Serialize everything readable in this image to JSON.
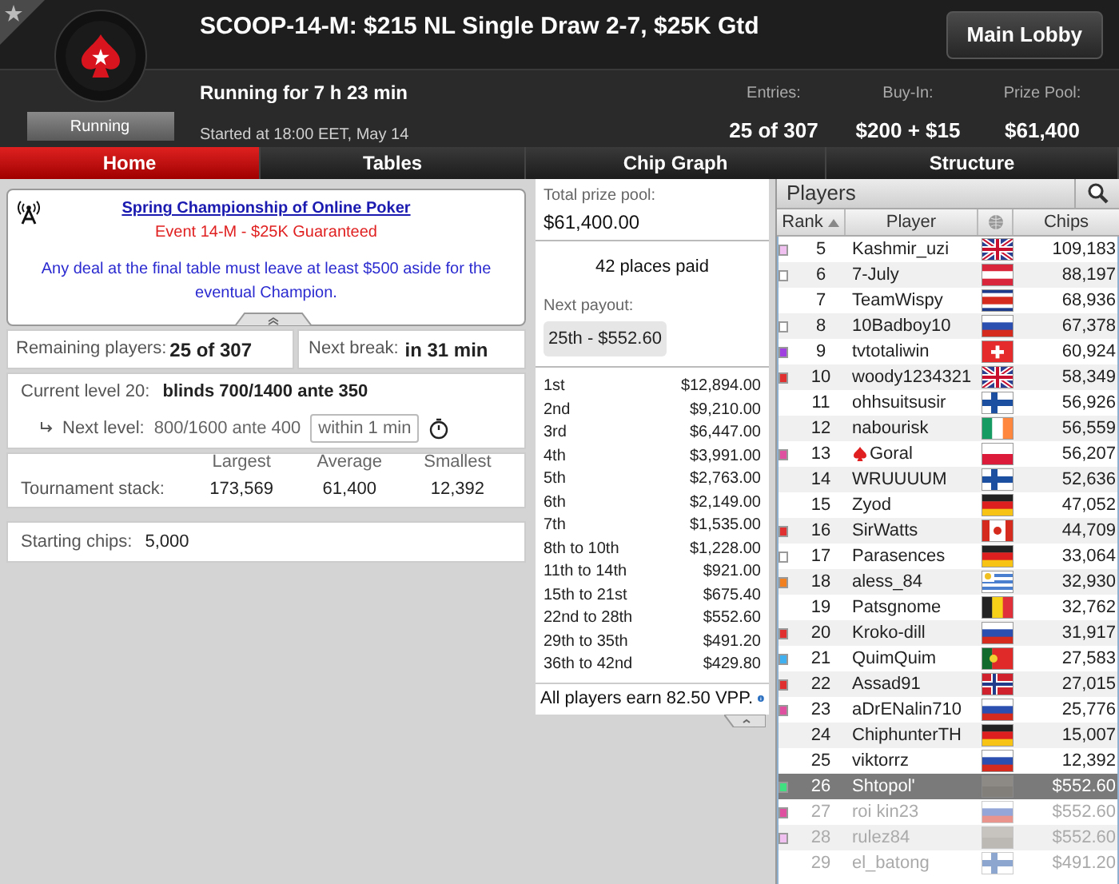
{
  "header": {
    "title": "SCOOP-14-M: $215 NL Single Draw 2-7, $25K Gtd",
    "status": "Running",
    "running_for": "Running for 7 h 23 min",
    "started": "Started at 18:00 EET, May 14",
    "main_lobby": "Main Lobby",
    "stats": [
      {
        "label": "Entries:",
        "value": "25 of 307"
      },
      {
        "label": "Buy-In:",
        "value": "$200 + $15"
      },
      {
        "label": "Prize Pool:",
        "value": "$61,400"
      }
    ]
  },
  "tabs": [
    {
      "label": "Home",
      "selected": true
    },
    {
      "label": "Tables",
      "selected": false
    },
    {
      "label": "Chip Graph",
      "selected": false
    },
    {
      "label": "Structure",
      "selected": false
    }
  ],
  "announcement": {
    "link": "Spring Championship of Online Poker",
    "event": "Event 14-M - $25K Guaranteed",
    "message": "Any deal at the final table must leave at least $500 aside for the eventual Champion."
  },
  "remaining": {
    "label": "Remaining players:",
    "value": "25 of 307"
  },
  "next_break": {
    "label": "Next break:",
    "value": "in 31 min"
  },
  "level": {
    "label": "Current level 20:",
    "value": "blinds 700/1400 ante 350",
    "next_label": "Next level:",
    "next_value": "800/1600 ante 400",
    "within": "within 1 min"
  },
  "stack": {
    "label": "Tournament stack:",
    "columns": [
      {
        "label": "Largest",
        "value": "173,569"
      },
      {
        "label": "Average",
        "value": "61,400"
      },
      {
        "label": "Smallest",
        "value": "12,392"
      }
    ]
  },
  "starting_chips": {
    "label": "Starting chips:",
    "value": "5,000"
  },
  "prizes": {
    "pool_label": "Total prize pool:",
    "pool": "$61,400.00",
    "places_paid": "42 places paid",
    "next_label": "Next payout:",
    "next": "25th - $552.60",
    "rows": [
      {
        "place": "1st",
        "amount": "$12,894.00"
      },
      {
        "place": "2nd",
        "amount": "$9,210.00"
      },
      {
        "place": "3rd",
        "amount": "$6,447.00"
      },
      {
        "place": "4th",
        "amount": "$3,991.00"
      },
      {
        "place": "5th",
        "amount": "$2,763.00"
      },
      {
        "place": "6th",
        "amount": "$2,149.00"
      },
      {
        "place": "7th",
        "amount": "$1,535.00"
      },
      {
        "place": "8th to 10th",
        "amount": "$1,228.00"
      },
      {
        "place": "11th to 14th",
        "amount": "$921.00"
      },
      {
        "place": "15th to 21st",
        "amount": "$675.40"
      },
      {
        "place": "22nd to 28th",
        "amount": "$552.60"
      },
      {
        "place": "29th to 35th",
        "amount": "$491.20"
      },
      {
        "place": "36th to 42nd",
        "amount": "$429.80"
      }
    ],
    "vpp": "All players earn 82.50 VPP."
  },
  "players": {
    "title": "Players",
    "columns": [
      "Rank",
      "Player",
      "Chips"
    ],
    "rows": [
      {
        "rank": "5",
        "name": "Kashmir_uzi",
        "flag": {
          "kind": "gb"
        },
        "chips": "109,183",
        "color": "#f0c0f0",
        "pro": false,
        "eliminated": false,
        "selected": false
      },
      {
        "rank": "6",
        "name": "7-July",
        "flag": {
          "kind": "at"
        },
        "chips": "88,197",
        "color": "#ffffff",
        "pro": false,
        "eliminated": false,
        "selected": false
      },
      {
        "rank": "7",
        "name": "TeamWispy",
        "flag": {
          "kind": "cr"
        },
        "chips": "68,936",
        "pro": false,
        "eliminated": false,
        "selected": false
      },
      {
        "rank": "8",
        "name": "10Badboy10",
        "flag": {
          "kind": "ru"
        },
        "chips": "67,378",
        "color": "#ffffff",
        "pro": false,
        "eliminated": false,
        "selected": false
      },
      {
        "rank": "9",
        "name": "tvtotaliwin",
        "flag": {
          "kind": "ch"
        },
        "chips": "60,924",
        "color": "#a040e0",
        "pro": false,
        "eliminated": false,
        "selected": false
      },
      {
        "rank": "10",
        "name": "woody1234321",
        "flag": {
          "kind": "gb"
        },
        "chips": "58,349",
        "color": "#e03030",
        "pro": false,
        "eliminated": false,
        "selected": false
      },
      {
        "rank": "11",
        "name": "ohhsuitsusir",
        "flag": {
          "kind": "fi"
        },
        "chips": "56,926",
        "pro": false,
        "eliminated": false,
        "selected": false
      },
      {
        "rank": "12",
        "name": "nabourisk",
        "flag": {
          "kind": "ie"
        },
        "chips": "56,559",
        "pro": false,
        "eliminated": false,
        "selected": false
      },
      {
        "rank": "13",
        "name": "Goral",
        "flag": {
          "kind": "pl"
        },
        "chips": "56,207",
        "color": "#e050a0",
        "pro": true,
        "eliminated": false,
        "selected": false
      },
      {
        "rank": "14",
        "name": "WRUUUUM",
        "flag": {
          "kind": "fi"
        },
        "chips": "52,636",
        "pro": false,
        "eliminated": false,
        "selected": false
      },
      {
        "rank": "15",
        "name": "Zyod",
        "flag": {
          "kind": "de"
        },
        "chips": "47,052",
        "pro": false,
        "eliminated": false,
        "selected": false
      },
      {
        "rank": "16",
        "name": "SirWatts",
        "flag": {
          "kind": "ca"
        },
        "chips": "44,709",
        "color": "#e03030",
        "pro": false,
        "eliminated": false,
        "selected": false
      },
      {
        "rank": "17",
        "name": "Parasences",
        "flag": {
          "kind": "de"
        },
        "chips": "33,064",
        "color": "#ffffff",
        "pro": false,
        "eliminated": false,
        "selected": false
      },
      {
        "rank": "18",
        "name": "aless_84",
        "flag": {
          "kind": "uy"
        },
        "chips": "32,930",
        "color": "#f08020",
        "pro": false,
        "eliminated": false,
        "selected": false
      },
      {
        "rank": "19",
        "name": "Patsgnome",
        "flag": {
          "kind": "be"
        },
        "chips": "32,762",
        "pro": false,
        "eliminated": false,
        "selected": false
      },
      {
        "rank": "20",
        "name": "Kroko-dill",
        "flag": {
          "kind": "ru"
        },
        "chips": "31,917",
        "color": "#e03030",
        "pro": false,
        "eliminated": false,
        "selected": false
      },
      {
        "rank": "21",
        "name": "QuimQuim",
        "flag": {
          "kind": "pt"
        },
        "chips": "27,583",
        "color": "#40b0f0",
        "pro": false,
        "eliminated": false,
        "selected": false
      },
      {
        "rank": "22",
        "name": "Assad91",
        "flag": {
          "kind": "no"
        },
        "chips": "27,015",
        "color": "#e03030",
        "pro": false,
        "eliminated": false,
        "selected": false
      },
      {
        "rank": "23",
        "name": "aDrENalin710",
        "flag": {
          "kind": "ru"
        },
        "chips": "25,776",
        "color": "#e050a0",
        "pro": false,
        "eliminated": false,
        "selected": false
      },
      {
        "rank": "24",
        "name": "ChiphunterTH",
        "flag": {
          "kind": "de"
        },
        "chips": "15,007",
        "pro": false,
        "eliminated": false,
        "selected": false
      },
      {
        "rank": "25",
        "name": "viktorrz",
        "flag": {
          "kind": "ru"
        },
        "chips": "12,392",
        "pro": false,
        "eliminated": false,
        "selected": false
      },
      {
        "rank": "26",
        "name": "Shtopol'",
        "flag": {
          "kind": "unknown"
        },
        "chips": "$552.60",
        "color": "#40e080",
        "pro": false,
        "eliminated": true,
        "selected": true
      },
      {
        "rank": "27",
        "name": "roi kin23",
        "flag": {
          "kind": "ru"
        },
        "chips": "$552.60",
        "color": "#e050a0",
        "pro": false,
        "eliminated": true,
        "selected": false
      },
      {
        "rank": "28",
        "name": "rulez84",
        "flag": {
          "kind": "unknown"
        },
        "chips": "$552.60",
        "color": "#f0c0f0",
        "pro": false,
        "eliminated": true,
        "selected": false
      },
      {
        "rank": "29",
        "name": "el_batong",
        "flag": {
          "kind": "fi"
        },
        "chips": "$491.20",
        "pro": false,
        "eliminated": true,
        "selected": false
      }
    ]
  }
}
